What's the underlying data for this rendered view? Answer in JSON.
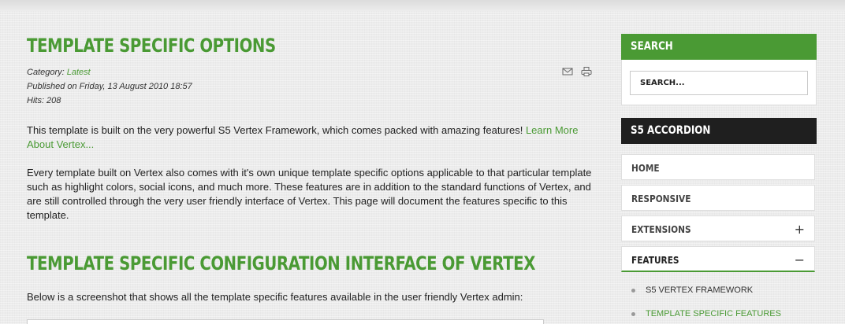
{
  "article": {
    "title": "TEMPLATE SPECIFIC OPTIONS",
    "category_label": "Category: ",
    "category_link": "Latest",
    "published": "Published on Friday, 13 August 2010 18:57",
    "hits": "Hits: 208",
    "p1_text": "This template is built on the very powerful S5 Vertex Framework, which comes packed with amazing features! ",
    "p1_link": "Learn More About Vertex...",
    "p2_text": "Every template built on Vertex also comes with it's own unique template specific options applicable to that particular template such as highlight colors, social icons, and much more. These features are in addition to the standard functions of Vertex, and are still controlled through the very user friendly interface of Vertex. This page will document the features specific to this template.",
    "section_title": "TEMPLATE SPECIFIC CONFIGURATION INTERFACE OF VERTEX",
    "p3_text": "Below is a screenshot that shows all the template specific features available in the user friendly Vertex admin:"
  },
  "sidebar": {
    "search_title": "SEARCH",
    "search_placeholder": "SEARCH...",
    "accordion_title": "S5 ACCORDION",
    "items": [
      {
        "label": "HOME",
        "toggle": ""
      },
      {
        "label": "RESPONSIVE",
        "toggle": ""
      },
      {
        "label": "EXTENSIONS",
        "toggle": "+"
      },
      {
        "label": "FEATURES",
        "toggle": "−"
      }
    ],
    "sub_items": [
      {
        "label": "S5 VERTEX FRAMEWORK"
      },
      {
        "label": "TEMPLATE SPECIFIC FEATURES"
      }
    ]
  },
  "icons": {
    "email": "envelope-icon",
    "print": "printer-icon"
  },
  "colors": {
    "accent": "#4a9a34",
    "dark_header": "#1f1f1f"
  }
}
